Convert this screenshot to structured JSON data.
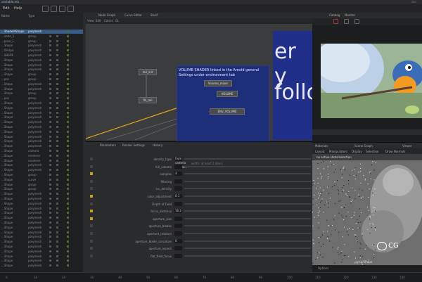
{
  "window": {
    "title": "unstable.mb",
    "right_title": "nan"
  },
  "menu": [
    "Edit",
    "Help"
  ],
  "outliner": {
    "header": [
      "Name",
      "Type"
    ],
    "rows": [
      {
        "name": "...ShadePIShape",
        "type": "polymesh",
        "selected": true
      },
      {
        "name": "...node_1",
        "type": "group"
      },
      {
        "name": "...pose_1",
        "type": "group"
      },
      {
        "name": "...Shape",
        "type": "polymesh"
      },
      {
        "name": "...IShape",
        "type": "polymesh"
      },
      {
        "name": "...SHAPE",
        "type": "polymesh"
      },
      {
        "name": "...Shape",
        "type": "polymesh"
      },
      {
        "name": "...Shape",
        "type": "polymesh"
      },
      {
        "name": "...Shape",
        "type": "polymesh"
      },
      {
        "name": "...Shape",
        "type": "group"
      },
      {
        "name": "...pos",
        "type": "group"
      },
      {
        "name": "...Shape",
        "type": "polymesh"
      },
      {
        "name": "...Shape",
        "type": "polymesh"
      },
      {
        "name": "...Shape",
        "type": "group"
      },
      {
        "name": "...pos",
        "type": "group"
      },
      {
        "name": "...Shape",
        "type": "polymesh"
      },
      {
        "name": "...Shape",
        "type": "polymesh"
      },
      {
        "name": "...Shape",
        "type": "polymesh"
      },
      {
        "name": "...Shape",
        "type": "polymesh"
      },
      {
        "name": "...Shape",
        "type": "polymesh"
      },
      {
        "name": "...Shape",
        "type": "polymesh"
      },
      {
        "name": "...Shape",
        "type": "polymesh"
      },
      {
        "name": "...Shape",
        "type": "polymesh"
      },
      {
        "name": "...Shape",
        "type": "polymesh"
      },
      {
        "name": "...Shape",
        "type": "polymesh"
      },
      {
        "name": "...Shape",
        "type": "camera"
      },
      {
        "name": "...Shape",
        "type": "renderer"
      },
      {
        "name": "...Shape",
        "type": "renderer"
      },
      {
        "name": "...Shape",
        "type": "polymesh"
      },
      {
        "name": "...Shape",
        "type": "polymesh"
      },
      {
        "name": "...Shape",
        "type": "group"
      },
      {
        "name": "...Shape",
        "type": "curve"
      },
      {
        "name": "...Shape",
        "type": "group"
      },
      {
        "name": "...Shape",
        "type": "group"
      },
      {
        "name": "...Shape",
        "type": "polymesh"
      },
      {
        "name": "...Shape",
        "type": "polymesh"
      },
      {
        "name": "...Shape",
        "type": "polymesh"
      },
      {
        "name": "...Shape",
        "type": "polymesh"
      },
      {
        "name": "...Shape",
        "type": "polymesh"
      },
      {
        "name": "...Shape",
        "type": "polymesh"
      },
      {
        "name": "...Shape",
        "type": "polymesh"
      },
      {
        "name": "...Shape",
        "type": "polymesh"
      },
      {
        "name": "...Shape",
        "type": "polymesh"
      },
      {
        "name": "...Shape",
        "type": "polymesh"
      },
      {
        "name": "...Shape",
        "type": "polymesh"
      },
      {
        "name": "...Shape",
        "type": "polymesh"
      },
      {
        "name": "...Shape",
        "type": "polymesh"
      },
      {
        "name": "...Shape",
        "type": "polymesh"
      },
      {
        "name": "...Shape",
        "type": "polymesh"
      },
      {
        "name": "...Shape",
        "type": "polymesh"
      }
    ]
  },
  "node_editor": {
    "tabs": [
      "Node Graph",
      "Curve Editor",
      "Shelf"
    ],
    "menu": [
      "View",
      "Edit",
      "Colors",
      "GL"
    ],
    "nodes": {
      "tail_in": "tail_init",
      "fill_tail": "fill_tail",
      "volume_mixer": "Volume_mixer",
      "volume": "VOLUME",
      "env_volume": "ENV_VOLUME"
    },
    "note": "VOLUME SHADER linked in the Arnold general Settings under environment  tab",
    "big_text": [
      "er y",
      "follo"
    ]
  },
  "parameters": {
    "tabs": [
      "Parameters",
      "Render Settings",
      "History"
    ],
    "rows": [
      {
        "label": "density_type",
        "value": "from camera location",
        "key": false
      },
      {
        "label": "full_volume",
        "value": "",
        "key": false
      },
      {
        "label": "samples",
        "value": "4",
        "key": true
      },
      {
        "label": "filtering",
        "value": "",
        "key": false
      },
      {
        "label": "src_density",
        "value": "",
        "key": false
      },
      {
        "label": "color_adjustment",
        "value": "0.1",
        "key": true
      },
      {
        "label": "Depth of Field",
        "value": "",
        "key": false
      },
      {
        "label": "focus_distance",
        "value": "16.2",
        "key": true
      },
      {
        "label": "aperture_size",
        "value": "",
        "key": true
      },
      {
        "label": "aperture_blades",
        "value": "",
        "key": false
      },
      {
        "label": "aperture_rotation",
        "value": "",
        "key": false
      },
      {
        "label": "aperture_blade_curvature",
        "value": "0",
        "key": false
      },
      {
        "label": "aperture_aspect",
        "value": "",
        "key": false
      },
      {
        "label": "flat_field_focus",
        "value": "",
        "key": false
      }
    ],
    "hint": "width: at least 2 dilers"
  },
  "right_panel": {
    "top_tabs": [
      "Catalog",
      "Monitor"
    ],
    "mid_tabs": [
      "Materials",
      "Scene Graph",
      "Viewer"
    ],
    "mid_menu": [
      "Layout",
      "Manipulators",
      "Display",
      "Selection",
      "Draw Normals"
    ],
    "viewport_label": "no active shots/selection",
    "footer_label": "persp/Shape",
    "options_label": "Options"
  },
  "watermark": "CG",
  "timeline": [
    "0",
    "10",
    "20",
    "30",
    "40",
    "50",
    "60",
    "70",
    "80",
    "90",
    "100",
    "110",
    "120",
    "130",
    "140"
  ]
}
